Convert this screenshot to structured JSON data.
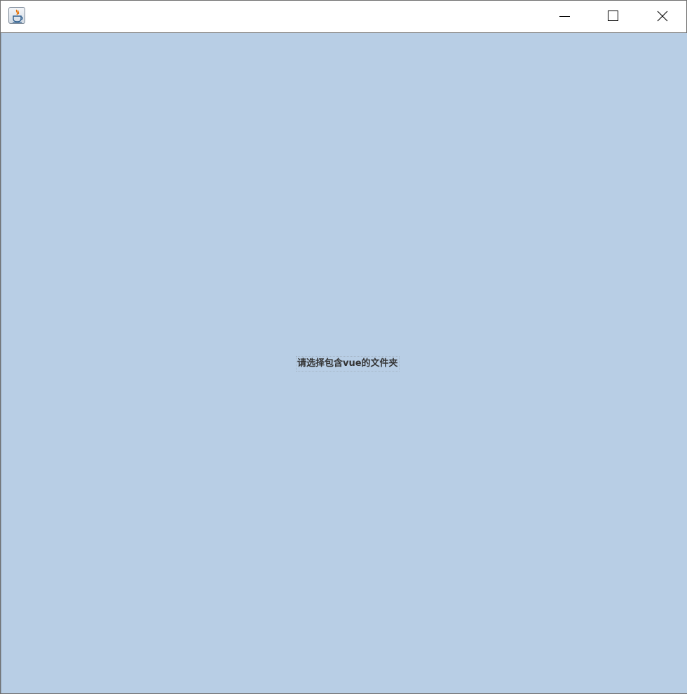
{
  "window": {
    "title": "",
    "icons": {
      "app": "java-coffee-cup-icon",
      "minimize": "minimize-icon",
      "maximize": "maximize-icon",
      "close": "close-icon"
    }
  },
  "content": {
    "prompt_text": "请选择包含vue的文件夹",
    "background_color": "#b8cee5"
  }
}
